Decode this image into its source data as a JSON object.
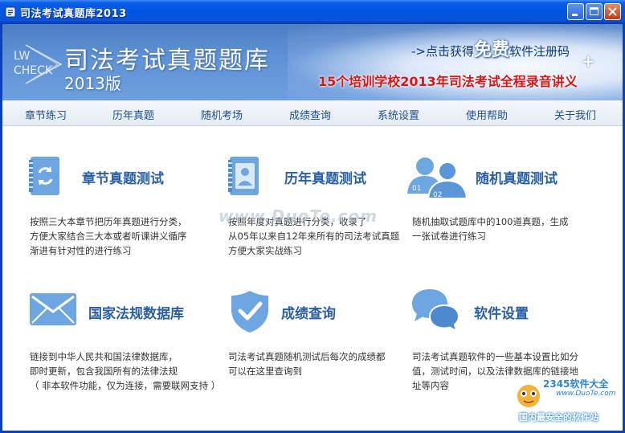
{
  "window": {
    "title": "司法考试真题库2013"
  },
  "banner": {
    "logo_line1": "LW",
    "logo_line2": "CHECK",
    "main_title": "司法考试真题题库",
    "edition": "2013版",
    "promo_prefix": "->点击获得",
    "promo_free": "免费",
    "promo_suffix": "软件注册码",
    "promo_plus": "+",
    "promo_line2": "15个培训学校2013年司法考试全程录音讲义"
  },
  "menu": {
    "items": [
      {
        "label": "章节练习"
      },
      {
        "label": "历年真题"
      },
      {
        "label": "随机考场"
      },
      {
        "label": "成绩查询"
      },
      {
        "label": "系统设置"
      },
      {
        "label": "使用帮助"
      },
      {
        "label": "关于我们"
      }
    ]
  },
  "features": [
    {
      "title": "章节真题测试",
      "icon": "refresh-notebook-icon",
      "desc": [
        "按照三大本章节把历年真题进行分类，",
        "方便大家结合三大本或者听课讲义循序",
        "渐进有针对性的进行练习"
      ]
    },
    {
      "title": "历年真题测试",
      "icon": "person-notebook-icon",
      "desc": [
        "按照年度对真题进行分类，收录了",
        "从05年以来自12年来所有的司法考试真题",
        "方便大家实战练习"
      ]
    },
    {
      "title": "随机真题测试",
      "icon": "users-icon",
      "icon_labels": [
        "01",
        "02"
      ],
      "desc": [
        "随机抽取试题库中的100道真题，生成",
        "一张试卷进行练习"
      ]
    },
    {
      "title": "国家法规数据库",
      "icon": "envelope-icon",
      "desc": [
        "链接到中华人民共和国法律数据库，",
        "即时更新，包含我国所有的法律法规",
        "（ 非本软件功能，仅为连接，需要联网支持 ）"
      ]
    },
    {
      "title": "成绩查询",
      "icon": "shield-check-icon",
      "desc": [
        "司法考试真题随机测试后每次的成绩都",
        "可以在这里查询到"
      ]
    },
    {
      "title": "软件设置",
      "icon": "chat-bubbles-icon",
      "desc": [
        "司法考试真题软件的一些基本设置比如分",
        "值，测试时间，以及法律数据库的链接地",
        "址等内容"
      ]
    }
  ],
  "watermark": {
    "text": "www.DuoTe.com"
  },
  "site_badge": {
    "brand": "2345软件大全",
    "url": "www.DuoTe.com",
    "slogan": "国内最安全的软件站"
  },
  "colors": {
    "titlebar": "#0054e3",
    "banner": "#5f92d6",
    "menu_text": "#1e4f8c",
    "feature_title": "#2a5fa6",
    "icon_blue": "#6ea6e2",
    "promo_red": "#e31212"
  }
}
